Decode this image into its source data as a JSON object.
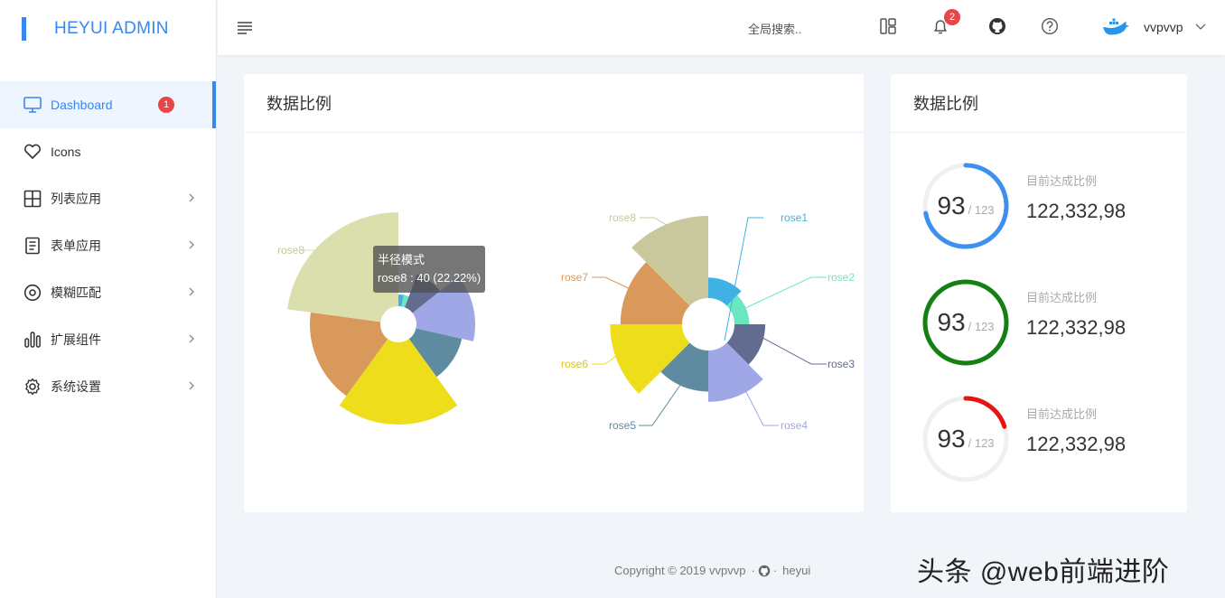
{
  "app": {
    "title": "HEYUI ADMIN"
  },
  "sidebar": {
    "items": [
      {
        "label": "Dashboard",
        "badge": "1",
        "active": true
      },
      {
        "label": "Icons"
      },
      {
        "label": "列表应用"
      },
      {
        "label": "表单应用"
      },
      {
        "label": "模糊匹配"
      },
      {
        "label": "扩展组件"
      },
      {
        "label": "系统设置"
      }
    ]
  },
  "header": {
    "search_placeholder": "全局搜索..",
    "notifications_count": "2",
    "username": "vvpvvp"
  },
  "left_card": {
    "title": "数据比例",
    "tooltip": {
      "title": "半径模式",
      "text": "rose8 : 40 (22.22%)"
    },
    "chart_labels": {
      "left_rose8": "rose8",
      "r1": "rose1",
      "r2": "rose2",
      "r3": "rose3",
      "r4": "rose4",
      "r5": "rose5",
      "r6": "rose6",
      "r7": "rose7",
      "r8": "rose8"
    }
  },
  "right_card": {
    "title": "数据比例",
    "stats": [
      {
        "value": "93",
        "total": "/ 123",
        "label": "目前达成比例",
        "amount": "122,332,98",
        "color": "#3d8ff0",
        "fraction": 0.72
      },
      {
        "value": "93",
        "total": "/ 123",
        "label": "目前达成比例",
        "amount": "122,332,98",
        "color": "#148014",
        "fraction": 1.0
      },
      {
        "value": "93",
        "total": "/ 123",
        "label": "目前达成比例",
        "amount": "122,332,98",
        "color": "#e81414",
        "fraction": 0.2
      }
    ]
  },
  "chart_data": [
    {
      "type": "pie",
      "title": "",
      "categories": [
        "rose1",
        "rose2",
        "rose3",
        "rose4",
        "rose5",
        "rose6",
        "rose7",
        "rose8"
      ],
      "values": [
        5,
        5,
        15,
        25,
        20,
        35,
        30,
        40
      ],
      "colors": [
        "#3fb1e3",
        "#6be6c1",
        "#626c91",
        "#a0a7e6",
        "#5e8ba0",
        "#eedd1a",
        "#d8995b",
        "#dadfad"
      ]
    },
    {
      "type": "pie",
      "title": "",
      "categories": [
        "rose1",
        "rose2",
        "rose3",
        "rose4",
        "rose5",
        "rose6",
        "rose7",
        "rose8"
      ],
      "values": [
        10,
        5,
        15,
        25,
        20,
        35,
        30,
        40
      ],
      "colors": [
        "#3fb1e3",
        "#6be6c1",
        "#626c91",
        "#a0a7e6",
        "#5e8ba0",
        "#eedd1a",
        "#d8995b",
        "#c9c89c"
      ]
    }
  ],
  "footer": {
    "copyright": "Copyright © 2019 vvpvvp",
    "dot1": "·",
    "dot2": "·",
    "link": "heyui"
  },
  "watermark": "头条 @web前端进阶"
}
